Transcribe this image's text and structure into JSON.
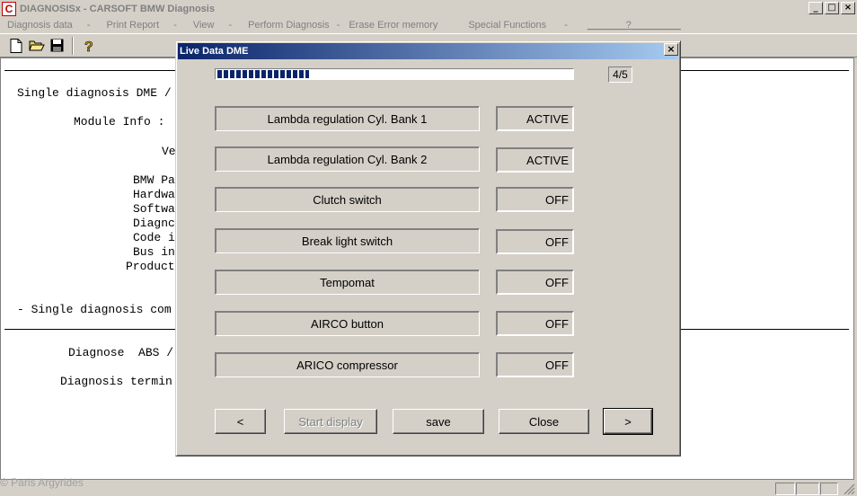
{
  "window": {
    "title": "DIAGNOSISx - CARSOFT BMW Diagnosis",
    "icon_letter": "C"
  },
  "menu": [
    {
      "label": "Diagnosis data"
    },
    {
      "label": "Print Report"
    },
    {
      "label": "View"
    },
    {
      "label": "Perform Diagnosis"
    },
    {
      "label": "Erase Error memory"
    },
    {
      "label": "Special Functions"
    }
  ],
  "menu_unknown": "_______?_________",
  "report": {
    "line1": "Single diagnosis DME /",
    "line2": "Module Info :",
    "line3": "Ve",
    "line4": "BMW Pa",
    "line5": "Hardwa",
    "line6": "Softwa",
    "line7": "Diagnc",
    "line8": "Code i",
    "line9": "Bus in",
    "line10": "Product",
    "line11": "- Single diagnosis com",
    "line12": "Diagnose  ABS /",
    "line13": "Diagnosis termin"
  },
  "watermark": "© Paris Argyrides",
  "dialog": {
    "title": "Live Data DME",
    "progress_fraction": 0.26,
    "page_indicator": "4/5",
    "rows": [
      {
        "label": "Lambda regulation Cyl. Bank 1",
        "value": "ACTIVE"
      },
      {
        "label": "Lambda regulation Cyl. Bank 2",
        "value": "ACTIVE"
      },
      {
        "label": "Clutch switch",
        "value": "OFF"
      },
      {
        "label": "Break light switch",
        "value": "OFF"
      },
      {
        "label": "Tempomat",
        "value": "OFF"
      },
      {
        "label": "AIRCO button",
        "value": "OFF"
      },
      {
        "label": "ARICO compressor",
        "value": "OFF"
      }
    ],
    "buttons": {
      "prev": "<",
      "start": "Start display",
      "save": "save",
      "close": "Close",
      "next": ">"
    }
  }
}
